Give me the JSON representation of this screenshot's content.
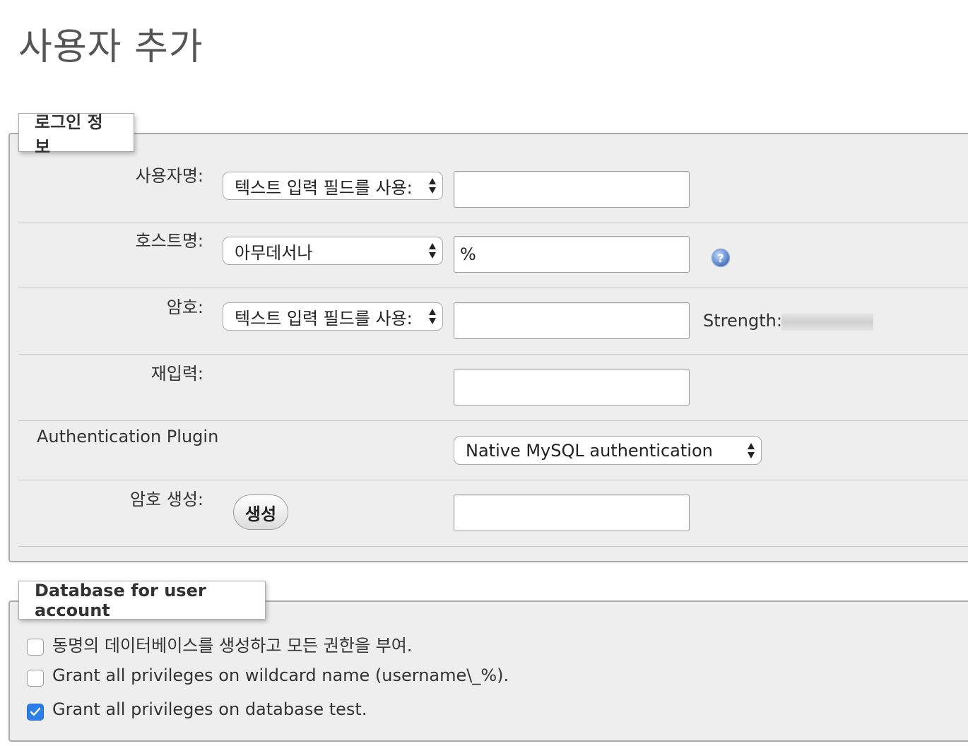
{
  "page": {
    "title": "사용자 추가"
  },
  "login_info": {
    "legend": "로그인 정보",
    "username": {
      "label": "사용자명:",
      "select_value": "텍스트 입력 필드를 사용:",
      "input_value": ""
    },
    "hostname": {
      "label": "호스트명:",
      "select_value": "아무데서나",
      "input_value": "%",
      "help_icon": "help-icon"
    },
    "password": {
      "label": "암호:",
      "select_value": "텍스트 입력 필드를 사용:",
      "input_value": "",
      "strength_label": "Strength:",
      "strength_value": 0
    },
    "retype": {
      "label": "재입력:",
      "input_value": ""
    },
    "auth_plugin": {
      "label": "Authentication Plugin",
      "select_value": "Native MySQL authentication"
    },
    "generate_password": {
      "label": "암호 생성:",
      "button_label": "생성",
      "input_value": ""
    }
  },
  "database": {
    "legend": "Database for user account",
    "options": [
      {
        "label": "동명의 데이터베이스를 생성하고 모든 권한을 부여.",
        "checked": false
      },
      {
        "label": "Grant all privileges on wildcard name (username\\_%).",
        "checked": false
      },
      {
        "label": "Grant all privileges on database test.",
        "checked": true
      }
    ]
  },
  "colors": {
    "panel_background": "#eeeeee",
    "checkbox_checked": "#2d7fe8",
    "help_icon": "#5b86c9"
  }
}
